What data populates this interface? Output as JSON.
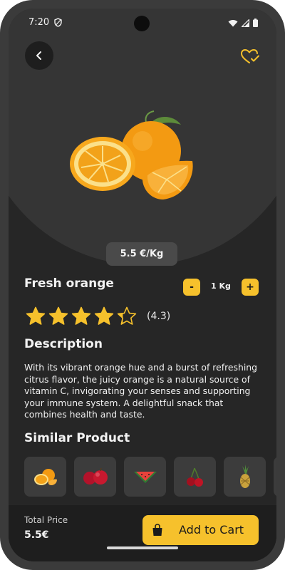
{
  "status_bar": {
    "time": "7:20",
    "icons": [
      "shield-icon",
      "wifi-icon",
      "signal-icon",
      "battery-icon"
    ]
  },
  "header": {
    "back_icon": "chevron-left-icon",
    "favorite_icon": "heart-check-icon"
  },
  "product": {
    "price_per_unit": "5.5 €/Kg",
    "name": "Fresh orange",
    "quantity": {
      "minus_label": "-",
      "value": "1 Kg",
      "plus_label": "+"
    },
    "rating": {
      "value": 4.3,
      "max": 5,
      "text": "(4.3)"
    }
  },
  "description": {
    "title": "Description",
    "body": "With its vibrant orange hue and a burst of refreshing citrus flavor, the juicy orange is a natural source of vitamin C, invigorating your senses and supporting your immune system. A delightful snack that combines health and taste."
  },
  "similar": {
    "title": "Similar Product",
    "items": [
      "orange-icon",
      "apple-icon",
      "watermelon-icon",
      "cherry-icon",
      "pineapple-icon"
    ]
  },
  "checkout": {
    "total_label": "Total Price",
    "total_value": "5.5€",
    "cart_label": "Add to Cart",
    "cart_icon": "shopping-bag-icon"
  },
  "colors": {
    "accent": "#f6c12c",
    "background": "#262626",
    "surface": "#353535",
    "bottom_bar": "#1e1e1e"
  }
}
